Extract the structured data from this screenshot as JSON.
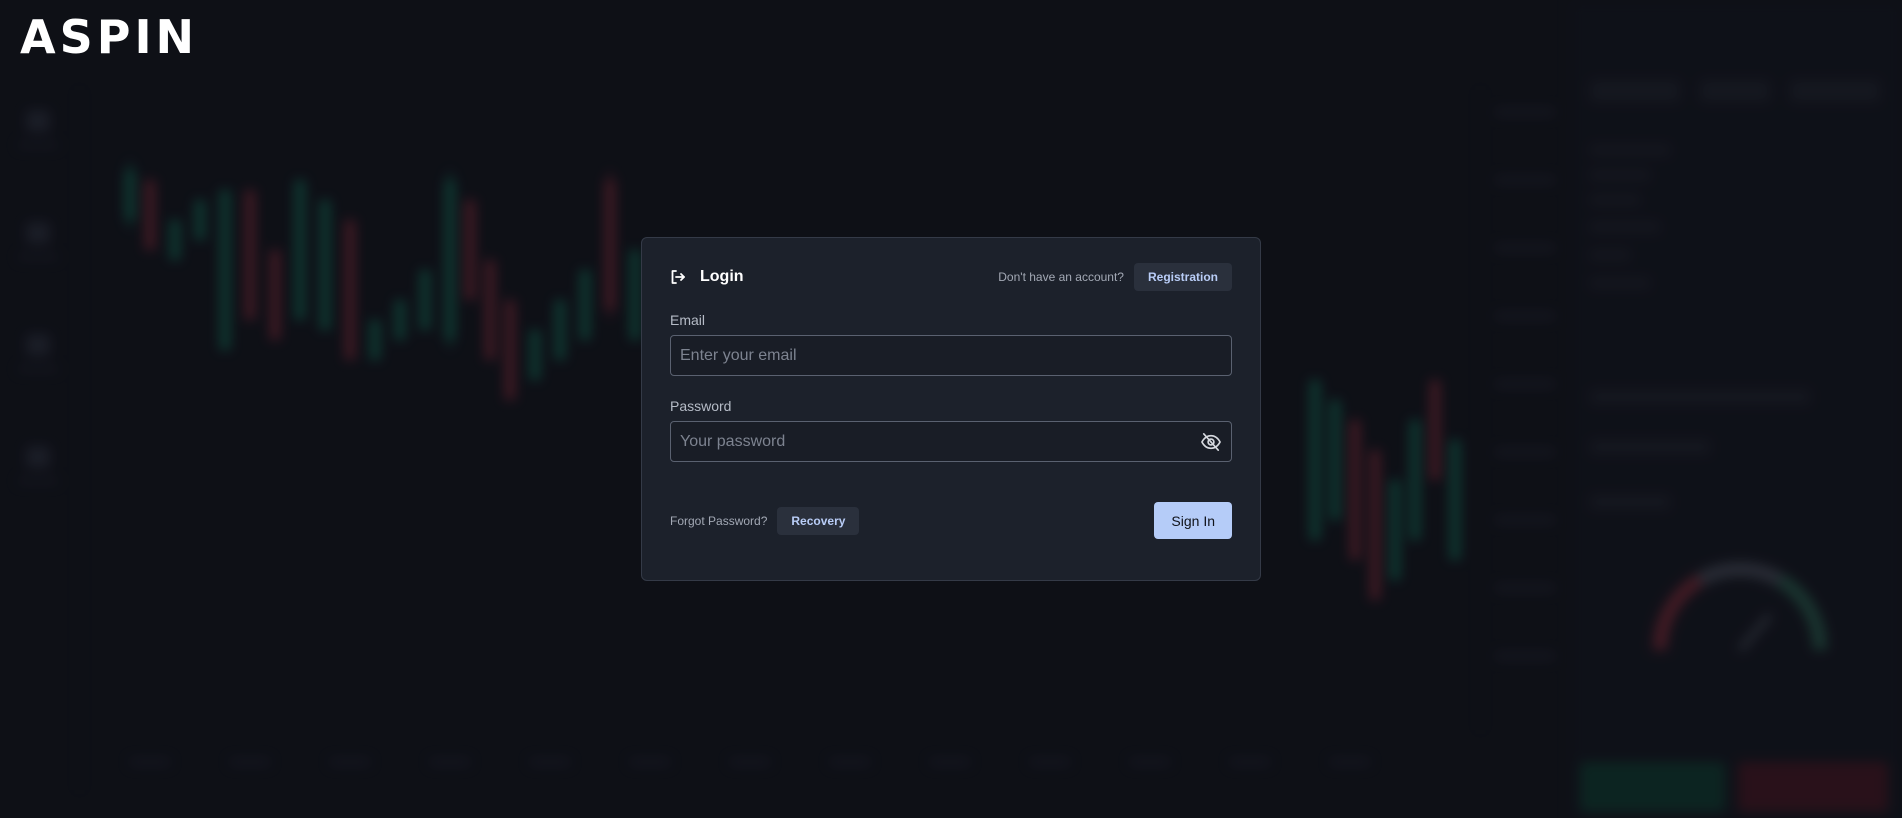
{
  "brand": {
    "logo_text": "ASPIN"
  },
  "login": {
    "title": "Login",
    "no_account_text": "Don't have an account?",
    "registration_label": "Registration",
    "email_label": "Email",
    "email_placeholder": "Enter your email",
    "email_value": "",
    "password_label": "Password",
    "password_placeholder": "Your password",
    "password_value": "",
    "forgot_text": "Forgot Password?",
    "recovery_label": "Recovery",
    "signin_label": "Sign In"
  },
  "icons": {
    "login": "login-icon",
    "password_visibility": "eye-off-icon"
  },
  "colors": {
    "background": "#11141b",
    "modal": "#1c212b",
    "accent": "#b5ccf8",
    "link_text": "#b9cdf7",
    "bullish": "#16a37a",
    "bearish": "#c03a4a"
  }
}
